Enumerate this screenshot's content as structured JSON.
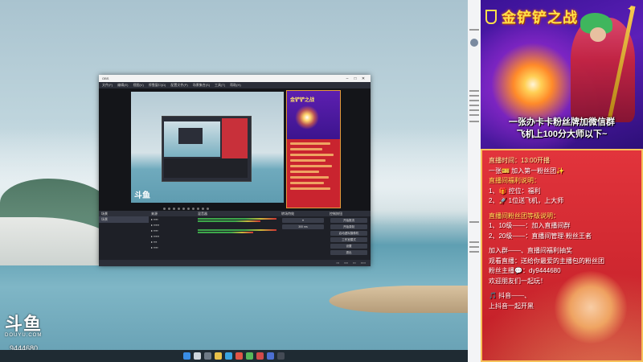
{
  "watermark": {
    "logo": "斗鱼",
    "site": "DOUYU.COM",
    "room_id": "9444680"
  },
  "obs": {
    "menu": [
      "文件(F)",
      "编辑(E)",
      "视图(V)",
      "停靠窗口(D)",
      "配置文件(P)",
      "场景集合(S)",
      "工具(T)",
      "帮助(H)"
    ],
    "docks": {
      "scenes": "场景",
      "sources": "来源",
      "mixer": "混音器",
      "transitions": "转场特效",
      "controls": "控制按钮"
    },
    "scene_item": "场景",
    "buttons": [
      "开始推流",
      "开始录制",
      "启动虚拟摄像机",
      "工作室模式",
      "设置",
      "退出"
    ]
  },
  "overlay": {
    "brand": "金铲铲之战",
    "slogan_1": "一张办卡卡粉丝牌加微信群",
    "slogan_2": "飞机上100分大师以下~",
    "lines": [
      {
        "text": "直播时间：13:00开播",
        "cls": "c"
      },
      {
        "text": "一张🎫 加入第一粉丝团✨",
        "cls": ""
      },
      {
        "text": "直播间福利说明：",
        "cls": "y"
      },
      {
        "text": "1、🎁 控位：福利",
        "cls": ""
      },
      {
        "text": "2、🚀 1位送飞机，上大师",
        "cls": ""
      },
      {
        "text": "",
        "cls": "gap"
      },
      {
        "text": "直播间粉丝团等级说明：",
        "cls": "y"
      },
      {
        "text": "1、10级——：加入直播间群",
        "cls": ""
      },
      {
        "text": "2、20级——：直播间管理·粉丝王者",
        "cls": ""
      },
      {
        "text": "",
        "cls": "gap"
      },
      {
        "text": "加入群——、直播间福利抽奖",
        "cls": ""
      },
      {
        "text": "观看直播：送给你最爱的主播包的粉丝团",
        "cls": ""
      },
      {
        "text": "粉丝主播💬：dy9444680",
        "cls": ""
      },
      {
        "text": "欢迎朋友们一起玩！",
        "cls": ""
      },
      {
        "text": "",
        "cls": "gap"
      },
      {
        "text": "🎵 抖音——、",
        "cls": ""
      },
      {
        "text": "上抖音一起开黑",
        "cls": ""
      }
    ]
  },
  "colors": {
    "overlay_red": "#c8222a",
    "overlay_gold": "#f7c25a",
    "obs_bg": "#2b2e38"
  }
}
